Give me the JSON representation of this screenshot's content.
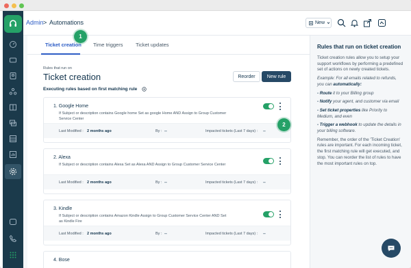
{
  "breadcrumb": {
    "root": "Admin",
    "separator": ">",
    "current": "Automations"
  },
  "header": {
    "new_button_label": "New",
    "new_button_icon": "plus-box-icon"
  },
  "tabs": [
    {
      "label": "Ticket creation",
      "active": true
    },
    {
      "label": "Time triggers",
      "active": false
    },
    {
      "label": "Ticket updates",
      "active": false
    }
  ],
  "annotations": {
    "badge_1": "1",
    "badge_2": "2"
  },
  "page": {
    "rules_label": "Rules that run on",
    "title": "Ticket creation",
    "reorder_label": "Reorder",
    "new_rule_label": "New rule",
    "exec_label": "Executing rules based on first matching rule"
  },
  "rules": [
    {
      "name": "1. Google Home",
      "description": "If Subject or description contains Google home Set as google Home AND Assign to Group Customer Service Center",
      "enabled": true,
      "modified_label": "Last Modified :",
      "modified_value": "2 months ago",
      "by_label": "By :",
      "by_value": "--",
      "impacted_label": "Impacted tickets (Last 7 days) :",
      "impacted_value": "--"
    },
    {
      "name": "2. Alexa",
      "description": "If Subject or description contains Alexa Set as Alexa AND Assign to Group Customer Service Center",
      "enabled": true,
      "modified_label": "Last Modified :",
      "modified_value": "2 months ago",
      "by_label": "By :",
      "by_value": "--",
      "impacted_label": "Impacted tickets (Last 7 days) :",
      "impacted_value": "--"
    },
    {
      "name": "3. Kindle",
      "description": "If Subject or description contains Amazon Kindle Assign to Group Customer Service Center AND Set as Kindle Fire",
      "enabled": true,
      "modified_label": "Last Modified :",
      "modified_value": "2 months ago",
      "by_label": "By :",
      "by_value": "--",
      "impacted_label": "Impacted tickets (Last 7 days) :",
      "impacted_value": "--"
    },
    {
      "name": "4. Bose"
    }
  ],
  "help": {
    "title": "Rules that run on ticket creation",
    "intro": "Ticket creation rules allow you to setup your support workflows by performing a predefined set of actions on newly created tickets.",
    "example": "Example: For all emails related to refunds, you can",
    "example_bold": "automatically:",
    "route_bold": "- Route",
    "route_rest": "it to your Billing group",
    "notify_bold": "- Notify",
    "notify_rest": "your agent, and customer via email",
    "props_bold": "- Set ticket properties",
    "props_rest": "like Priority to Medium, and even",
    "webhook_bold": "- Trigger a webhook",
    "webhook_rest": "to update the details in your billing software.",
    "remember": "Remember, the order of the 'Ticket Creation' rules are important. For each incoming ticket, the first matching rule will get executed, and stop. You can reorder the list of rules to have the most important rules on top."
  },
  "colors": {
    "accent": "#2c5cc5",
    "brand_green": "#25a167",
    "sidebar": "#1b3a4b",
    "primary_button": "#264966"
  }
}
